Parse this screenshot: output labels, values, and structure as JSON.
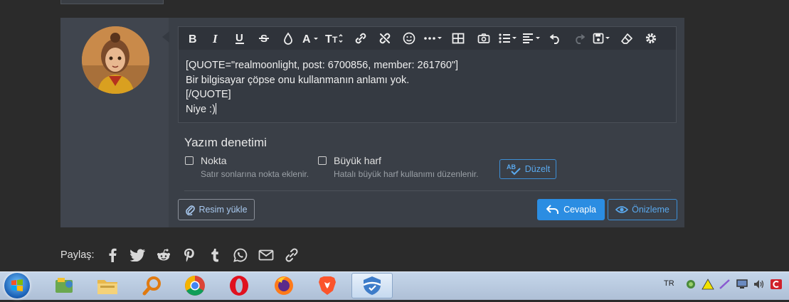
{
  "toolbar": {
    "buttons": [
      "bold",
      "italic",
      "underline",
      "strikethrough",
      "text-color",
      "font-family",
      "font-size",
      "insert-link",
      "remove-link",
      "emoji",
      "more-options",
      "insert-table",
      "insert-image",
      "list",
      "align",
      "undo",
      "redo",
      "drafts",
      "remove-formatting",
      "settings"
    ]
  },
  "editor": {
    "lines": [
      "[QUOTE=\"realmoonlight, post: 6700856, member: 261760\"]",
      "Bir bilgisayar çöpse onu kullanmanın anlamı yok.",
      "[/QUOTE]",
      "Niye :)"
    ]
  },
  "spellcheck": {
    "title": "Yazım denetimi",
    "option1_label": "Nokta",
    "option1_hint": "Satır sonlarına nokta eklenir.",
    "option2_label": "Büyük harf",
    "option2_hint": "Hatalı büyük harf kullanımı düzenlenir.",
    "fix_label": "Düzelt",
    "fix_icon_text": "AB"
  },
  "actions": {
    "upload_label": "Resim yükle",
    "reply_label": "Cevapla",
    "preview_label": "Önizleme"
  },
  "share": {
    "label": "Paylaş:",
    "icons": [
      "facebook-icon",
      "twitter-icon",
      "reddit-icon",
      "pinterest-icon",
      "tumblr-icon",
      "whatsapp-icon",
      "email-icon",
      "link-icon"
    ]
  },
  "taskbar": {
    "apps": [
      "windows-explorer",
      "file-manager",
      "search-tool",
      "chrome",
      "opera",
      "firefox",
      "brave",
      "security-app"
    ],
    "language": "TR"
  },
  "colors": {
    "accent": "#2b8de2",
    "background": "#2b2b2b",
    "card": "#3a3f47"
  }
}
